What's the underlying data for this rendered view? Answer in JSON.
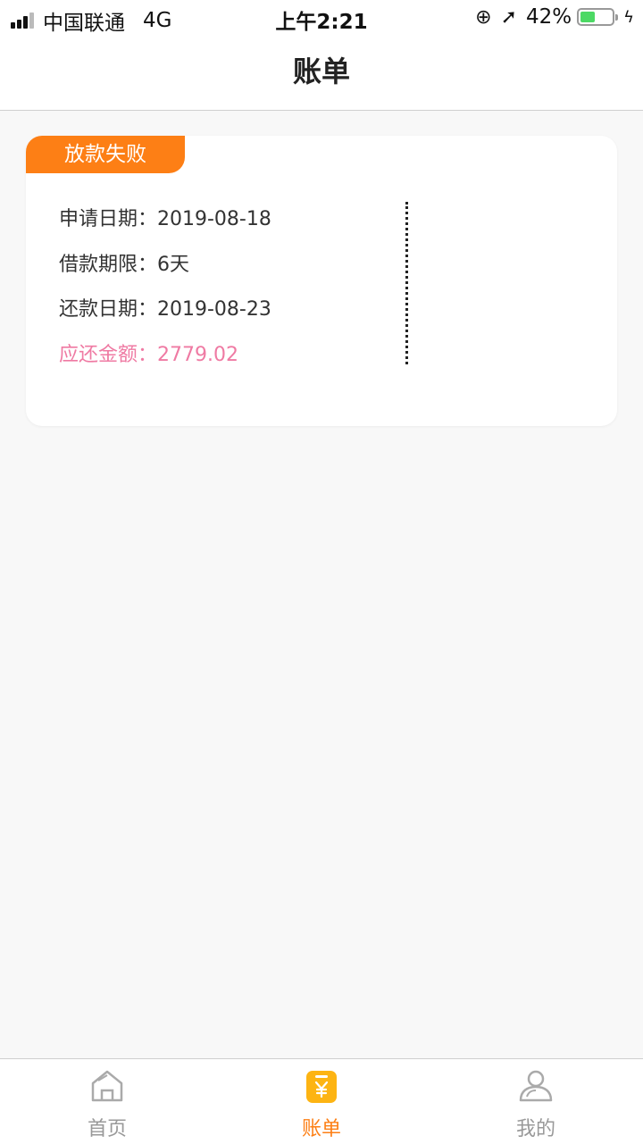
{
  "status_bar": {
    "carrier": "中国联通",
    "network": "4G",
    "time": "上午2:21",
    "battery": "42%"
  },
  "nav": {
    "title": "账单"
  },
  "bill_card": {
    "status_badge": "放款失败",
    "apply_date": "申请日期：2019-08-18",
    "loan_term": "借款期限：6天",
    "repay_date": "还款日期：2019-08-23",
    "amount_due": "应还金额：2779.02"
  },
  "tab_bar": {
    "tabs": [
      {
        "label": "首页",
        "icon": "home-icon"
      },
      {
        "label": "账单",
        "icon": "bill-icon"
      },
      {
        "label": "我的",
        "icon": "user-icon"
      }
    ],
    "active_color": "#fd7f15",
    "inactive_color": "#999999"
  }
}
